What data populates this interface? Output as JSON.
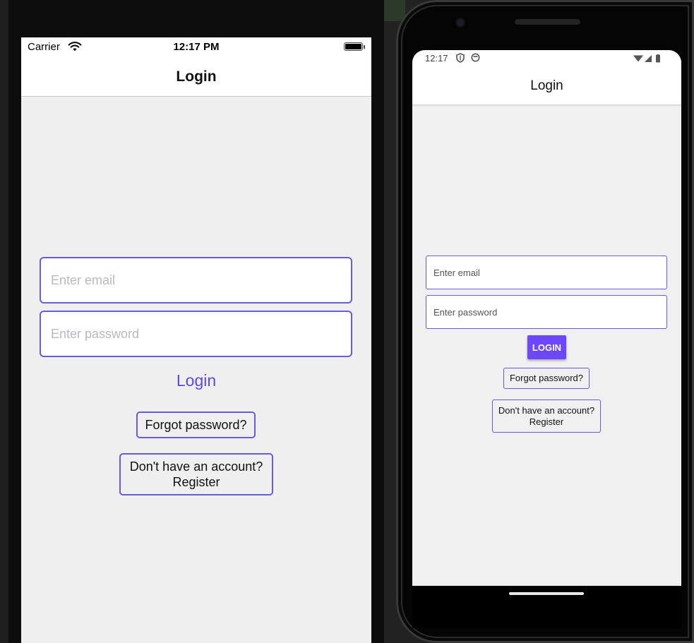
{
  "ios": {
    "status": {
      "carrier": "Carrier",
      "time": "12:17 PM"
    },
    "nav_title": "Login",
    "email_placeholder": "Enter email",
    "password_placeholder": "Enter password",
    "login_label": "Login",
    "forgot_label": "Forgot password?",
    "register_line1": "Don't have an account?",
    "register_line2": "Register",
    "accent_color": "#6a5ae0"
  },
  "android": {
    "status": {
      "time": "12:17"
    },
    "title": "Login",
    "email_placeholder": "Enter email",
    "password_placeholder": "Enter password",
    "login_label": "LOGIN",
    "forgot_label": "Forgot password?",
    "register_line1": "Don't have an account?",
    "register_line2": "Register",
    "accent_color": "#6c47ff"
  },
  "icons": [
    "wifi-icon",
    "battery-icon",
    "shield-icon",
    "circle-icon",
    "signal-icon"
  ]
}
